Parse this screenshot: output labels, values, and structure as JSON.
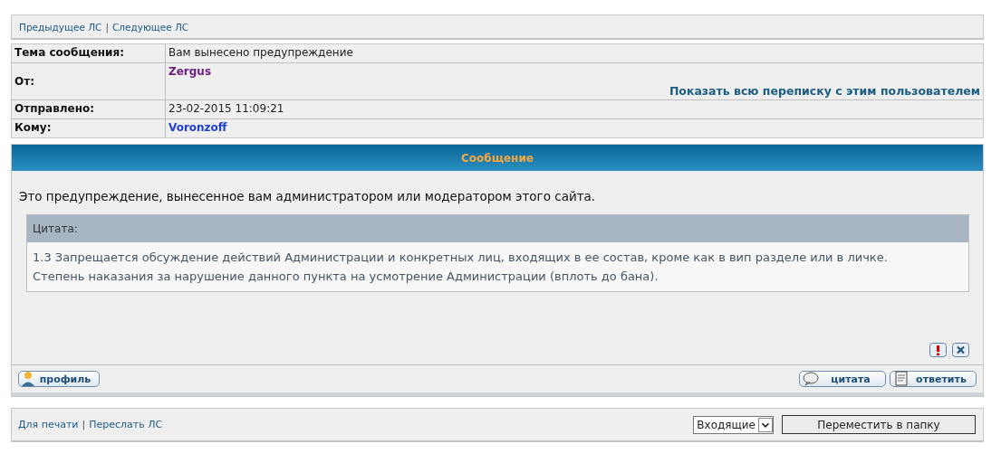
{
  "nav_links": [
    {
      "label": "Предыдущее ЛС"
    },
    {
      "label": "Следующее ЛС"
    }
  ],
  "nav_separator": "|",
  "header_rows": [
    {
      "label": "Тема сообщения:",
      "value": "Вам вынесено предупреждение",
      "kind": "text"
    },
    {
      "label": "От:",
      "value": "Zergus",
      "kind": "user",
      "color": "#6b1d7f",
      "link": "Показать всю переписку с этим пользователем"
    },
    {
      "label": "Отправлено:",
      "value": "23-02-2015 11:09:21",
      "kind": "text"
    },
    {
      "label": "Кому:",
      "value": "Voronzoff",
      "kind": "user",
      "color": "#1d3fcf"
    }
  ],
  "message": {
    "title": "Сообщение",
    "text": "Это предупреждение, вынесенное вам администратором или модератором этого сайта.",
    "quote": {
      "title": "Цитата:",
      "lines": [
        "1.3 Запрещается обсуждение действий Администрации и конкретных лиц, входящих в ее состав, кроме как в вип разделе или в личке.",
        "Степень наказания за нарушение данного пункта на усмотрение Администрации (вплоть до бана)."
      ]
    },
    "post_icons": [
      {
        "kind": "report"
      },
      {
        "kind": "delete"
      }
    ],
    "left_buttons": [
      {
        "label": "профиль",
        "kind": "profile"
      }
    ],
    "right_buttons": [
      {
        "label": "цитата",
        "kind": "quote"
      },
      {
        "label": "ответить",
        "kind": "reply"
      }
    ]
  },
  "footer": {
    "links": [
      {
        "label": "Для печати"
      },
      {
        "label": "Переслать ЛС"
      }
    ],
    "separator": "|",
    "folder": "Входящие",
    "move_button": "Переместить в папку"
  }
}
